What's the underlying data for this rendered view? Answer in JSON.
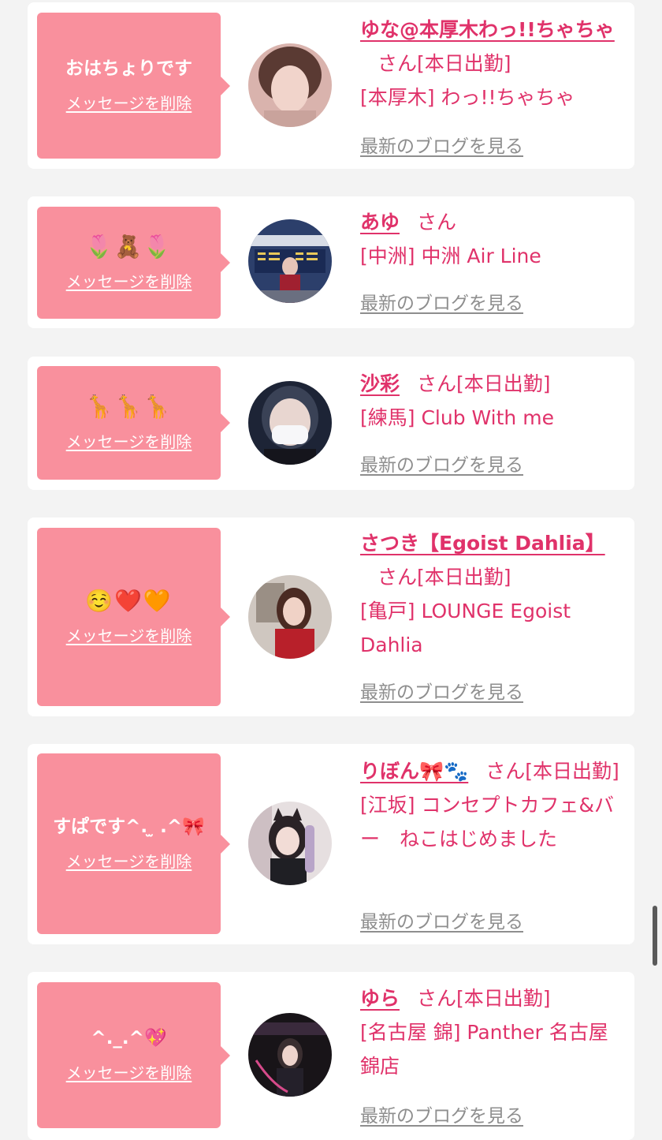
{
  "common": {
    "delete_label": "メッセージを削除",
    "blog_label": "最新のブログを見る",
    "san_label": "さん"
  },
  "cards": [
    {
      "message": "おはちょりです",
      "name": "ゆな@本厚木わっ!!ちゃちゃ",
      "status": "[本日出勤]",
      "shop": "[本厚木] わっ!!ちゃちゃ"
    },
    {
      "message": "🌷🧸🌷",
      "name": "あゆ",
      "status": "",
      "shop": "[中洲] 中洲 Air Line"
    },
    {
      "message": "🦒🦒🦒",
      "name": "沙彩",
      "status": "[本日出勤]",
      "shop": "[練馬] Club With me"
    },
    {
      "message": "☺️❤️🧡",
      "name": "さつき【Egoist Dahlia】",
      "status": "[本日出勤]",
      "shop": "[亀戸] LOUNGE Egoist Dahlia"
    },
    {
      "message": "すぱです^. ̫ .^🎀",
      "name": "りぼん🎀🐾",
      "status": "[本日出勤]",
      "shop": "[江坂] コンセプトカフェ&バー　ねこはじめました"
    },
    {
      "message": "^._.^💖",
      "name": "ゆら",
      "status": "[本日出勤]",
      "shop": "[名古屋 錦] Panther 名古屋錦店"
    }
  ],
  "colors": {
    "bubble": "#f9909d",
    "accent": "#e0326a",
    "muted": "#8e8e8e",
    "background": "#f3f3f3"
  }
}
